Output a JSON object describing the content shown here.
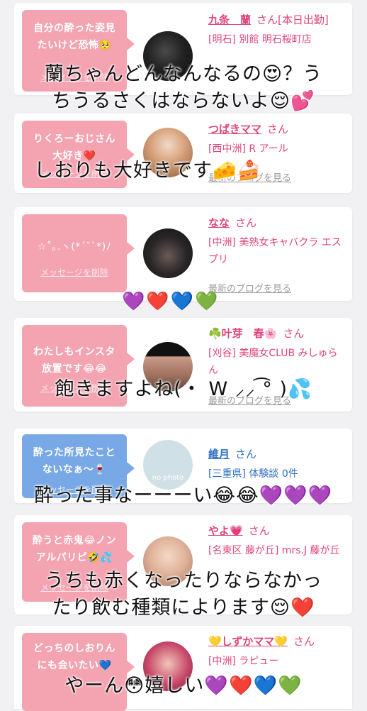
{
  "cards": [
    {
      "message": "自分の酔った姿見\nたいけど恐怖🥺",
      "delete_label": "メッセージを削除",
      "name": "九条　蘭",
      "honorific": "さん[本日出勤]",
      "shop": "[明石] 別館 明石桜町店",
      "blog": "",
      "color": "pink"
    },
    {
      "message": "りくろーおじさん\n大好き❤️",
      "delete_label": "メッセージを削除",
      "name": "つばきママ",
      "honorific": "さん",
      "shop": "[西中洲] R アール",
      "blog": "最新のブログを見る",
      "color": "pink"
    },
    {
      "message": "☆˚｡.ヽ(*´˘`*)ﾉ",
      "delete_label": "メッセージを削除",
      "name": "なな",
      "honorific": "さん",
      "shop": "[中洲] 美熟女キャバクラ エスプリ",
      "blog": "最新のブログを見る",
      "color": "pink"
    },
    {
      "message": "わたしもインスタ\n放置です😂😂",
      "delete_label": "メッセージを削除",
      "name": "☘️叶芽　春🌸",
      "honorific": "さん",
      "shop": "[刈谷] 美魔女CLUB みしゅらん",
      "blog": "最新のブログを見る",
      "color": "pink"
    },
    {
      "message": "酔った所見たこと\nないなぁ～🍷",
      "delete_label": "メッセージを削除",
      "name": "維月",
      "honorific": "さん",
      "shop": "[三重県] 体験談 0件",
      "blog": "",
      "avatar_text": "no photo",
      "color": "blue"
    },
    {
      "message": "酔うと赤鬼😂ノン\nアルパリピ🤣💦",
      "delete_label": "メッセージを削除",
      "name": "やよ💗",
      "honorific": "さん",
      "shop": "[名東区 藤が丘] mrs.J 藤が丘",
      "blog": "",
      "color": "pink"
    },
    {
      "message": "どっちのしおりん\nにも会いたい💙",
      "delete_label": "",
      "name": "💛しずかママ💛",
      "honorific": "さん",
      "shop": "[中洲] ラピュー",
      "blog": "",
      "color": "pink"
    }
  ],
  "overlays": [
    "蘭ちゃんどんなんなるの😍？う\nちうるさくはならないよ😌💕",
    "しおりも大好きです🧀🍰",
    "💜❤️💙💚",
    "飽きますよね(・ W ⸝⸝ ͡° )💦",
    "酔った事なーーーい😂😂💜💜💜",
    "うちも赤くなったりならなかっ\nたり飲む種類によります😌❤️",
    "やーん😳嬉しい💜❤️💙💚"
  ]
}
